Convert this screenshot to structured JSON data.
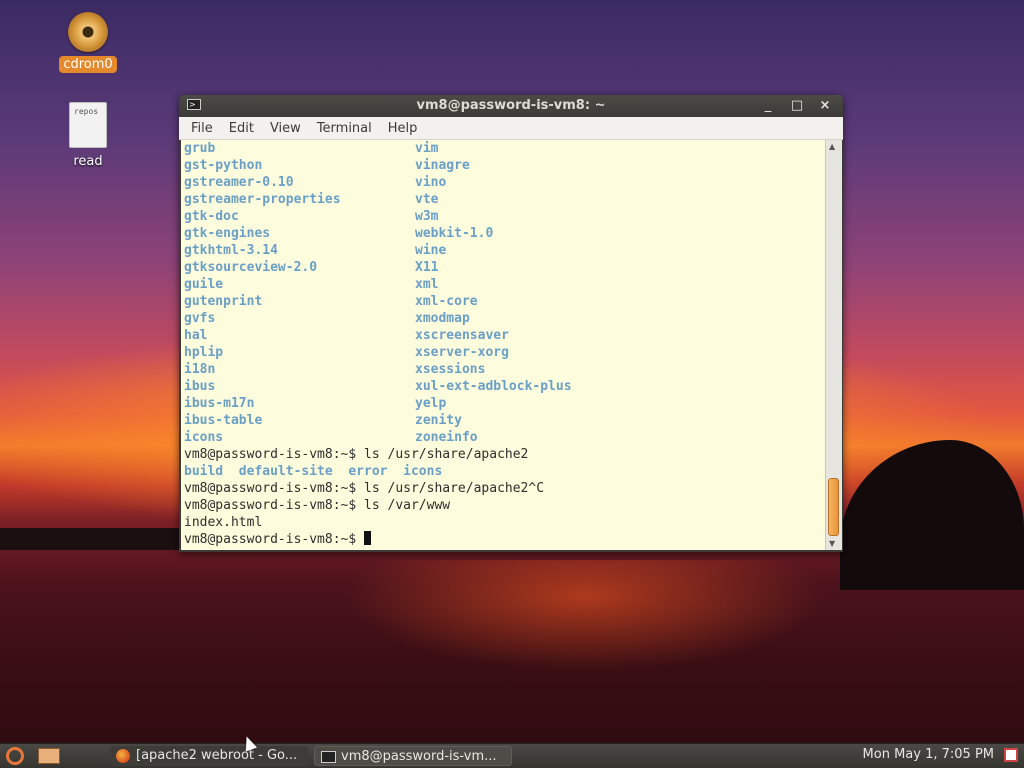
{
  "desktop": {
    "icons": [
      {
        "label": "cdrom0",
        "icon": "cdrom-icon"
      },
      {
        "label": "read",
        "icon": "text-file-icon",
        "thumb_text": "repos"
      }
    ]
  },
  "window": {
    "title": "vm8@password-is-vm8: ~",
    "menu": [
      "File",
      "Edit",
      "View",
      "Terminal",
      "Help"
    ],
    "controls": {
      "minimize": "_",
      "maximize": "□",
      "close": "×"
    }
  },
  "terminal": {
    "dir_rows": [
      [
        "grub",
        "vim"
      ],
      [
        "gst-python",
        "vinagre"
      ],
      [
        "gstreamer-0.10",
        "vino"
      ],
      [
        "gstreamer-properties",
        "vte"
      ],
      [
        "gtk-doc",
        "w3m"
      ],
      [
        "gtk-engines",
        "webkit-1.0"
      ],
      [
        "gtkhtml-3.14",
        "wine"
      ],
      [
        "gtksourceview-2.0",
        "X11"
      ],
      [
        "guile",
        "xml"
      ],
      [
        "gutenprint",
        "xml-core"
      ],
      [
        "gvfs",
        "xmodmap"
      ],
      [
        "hal",
        "xscreensaver"
      ],
      [
        "hplip",
        "xserver-xorg"
      ],
      [
        "i18n",
        "xsessions"
      ],
      [
        "ibus",
        "xul-ext-adblock-plus"
      ],
      [
        "ibus-m17n",
        "yelp"
      ],
      [
        "ibus-table",
        "zenity"
      ],
      [
        "icons",
        "zoneinfo"
      ]
    ],
    "cmd1": "vm8@password-is-vm8:~$ ls /usr/share/apache2",
    "cmd1_output": "build  default-site  error  icons",
    "cmd2": "vm8@password-is-vm8:~$ ls /usr/share/apache2^C",
    "cmd3": "vm8@password-is-vm8:~$ ls /var/www",
    "cmd3_output": "index.html",
    "prompt": "vm8@password-is-vm8:~$ "
  },
  "panel": {
    "tasks": [
      {
        "label": "[apache2 webroot - Go...",
        "icon": "firefox-icon"
      },
      {
        "label": "vm8@password-is-vm...",
        "icon": "terminal-icon"
      }
    ],
    "clock": "Mon May  1,  7:05 PM"
  },
  "colors": {
    "dir_text": "#6aa0c8",
    "terminal_bg": "#fdfcdc",
    "accent_orange": "#e58a2c"
  }
}
